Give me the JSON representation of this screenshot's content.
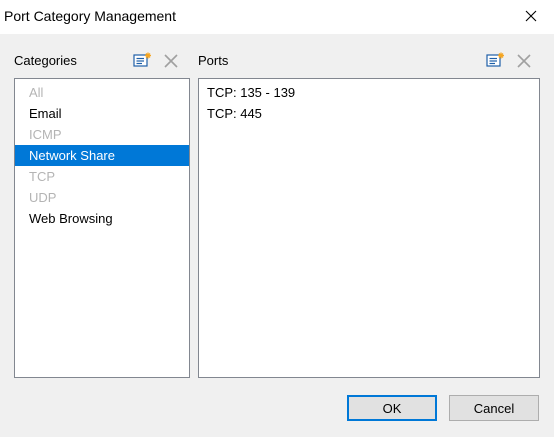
{
  "window": {
    "title": "Port Category Management",
    "close_icon": "close-icon"
  },
  "categories_panel": {
    "header": "Categories",
    "icons": [
      "new-item-icon",
      "delete-icon"
    ],
    "items": [
      {
        "label": "All",
        "state": "disabled"
      },
      {
        "label": "Email",
        "state": "normal"
      },
      {
        "label": "ICMP",
        "state": "disabled"
      },
      {
        "label": "Network Share",
        "state": "selected"
      },
      {
        "label": "TCP",
        "state": "disabled"
      },
      {
        "label": "UDP",
        "state": "disabled"
      },
      {
        "label": "Web Browsing",
        "state": "normal"
      }
    ]
  },
  "ports_panel": {
    "header": "Ports",
    "icons": [
      "new-item-icon",
      "delete-icon"
    ],
    "items": [
      "TCP: 135 - 139",
      "TCP: 445"
    ]
  },
  "buttons": {
    "ok": "OK",
    "cancel": "Cancel"
  },
  "colors": {
    "selection": "#0078d7",
    "disabled_text": "#b4b4b4",
    "default_button_border": "#0078d7",
    "new_icon_accent": "#f5a623",
    "new_icon_blue": "#1e5fa8"
  }
}
